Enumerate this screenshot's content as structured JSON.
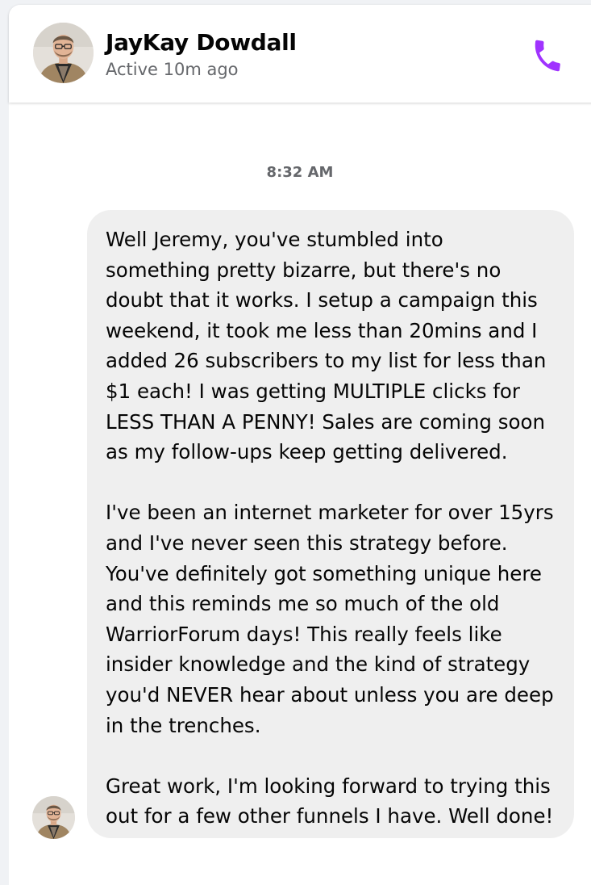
{
  "header": {
    "contact_name": "JayKay Dowdall",
    "contact_status": "Active 10m ago",
    "call_icon": "phone-icon",
    "accent_color": "#a033ff"
  },
  "conversation": {
    "timestamp": "8:32 AM",
    "message": {
      "paragraphs": [
        [
          "Well Jeremy, you've stumbled into",
          "something pretty bizarre, but there's no",
          "doubt that it works. I setup a campaign this",
          "weekend, it took me less than 20mins and I",
          "added 26 subscribers to my list for less than",
          "$1 each! I was getting MULTIPLE clicks for",
          "LESS THAN A PENNY! Sales are coming soon",
          "as my follow-ups keep getting delivered."
        ],
        [
          "I've been an internet marketer for over 15yrs",
          "and I've never seen this strategy before.",
          "You've definitely got something unique here",
          "and this reminds me so much of the old",
          "WarriorForum days! This really feels like",
          "insider knowledge and the kind of strategy",
          "you'd NEVER hear about unless you are deep",
          "in the trenches."
        ],
        [
          "Great work, I'm looking forward to trying this",
          "out for a few other funnels I have. Well done!"
        ]
      ]
    }
  }
}
